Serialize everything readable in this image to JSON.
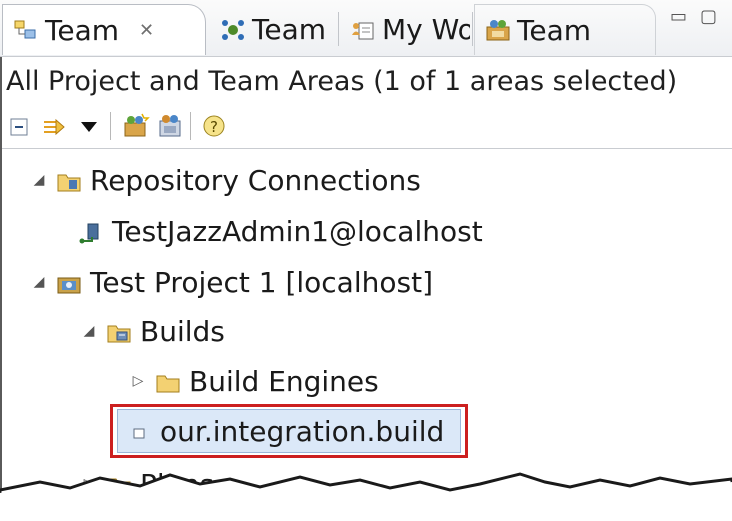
{
  "tabs": [
    {
      "label": "Team",
      "icon": "team-artifacts-icon",
      "active": true,
      "close": "✕"
    },
    {
      "label": "Team",
      "icon": "team-central-icon"
    },
    {
      "label": "My Wo",
      "icon": "my-work-icon"
    },
    {
      "label": "Team",
      "icon": "team-organization-icon"
    }
  ],
  "window_controls": {
    "minimize": "▭",
    "maximize": "▢"
  },
  "view": {
    "title": "All Project and Team Areas (1 of 1 areas selected)"
  },
  "toolbar": {
    "icons": [
      "collapse-all-icon",
      "link-with-editor-icon",
      "view-menu-dropdown-icon",
      "new-project-area-icon",
      "new-team-area-icon",
      "help-icon"
    ]
  },
  "tree": [
    {
      "label": "Repository Connections",
      "icon": "repository-connections-icon",
      "expanded": true,
      "level": 0
    },
    {
      "label": "TestJazzAdmin1@localhost",
      "icon": "connection-icon",
      "level": 1
    },
    {
      "label": "Test Project 1 [localhost]",
      "icon": "project-area-icon",
      "expanded": true,
      "level": 0
    },
    {
      "label": "Builds",
      "icon": "builds-icon",
      "expanded": true,
      "level": 1
    },
    {
      "label": "Build Engines",
      "icon": "folder-icon",
      "expanded": false,
      "level": 2
    },
    {
      "label": "our.integration.build",
      "icon": "build-definition-icon",
      "selected": true,
      "level": 2
    },
    {
      "label": "Plans",
      "icon": "plans-icon",
      "expanded": false,
      "level": 1
    }
  ],
  "colors": {
    "selection_outline": "#cc1f1f",
    "selection_fill": "#dbe8f8"
  }
}
